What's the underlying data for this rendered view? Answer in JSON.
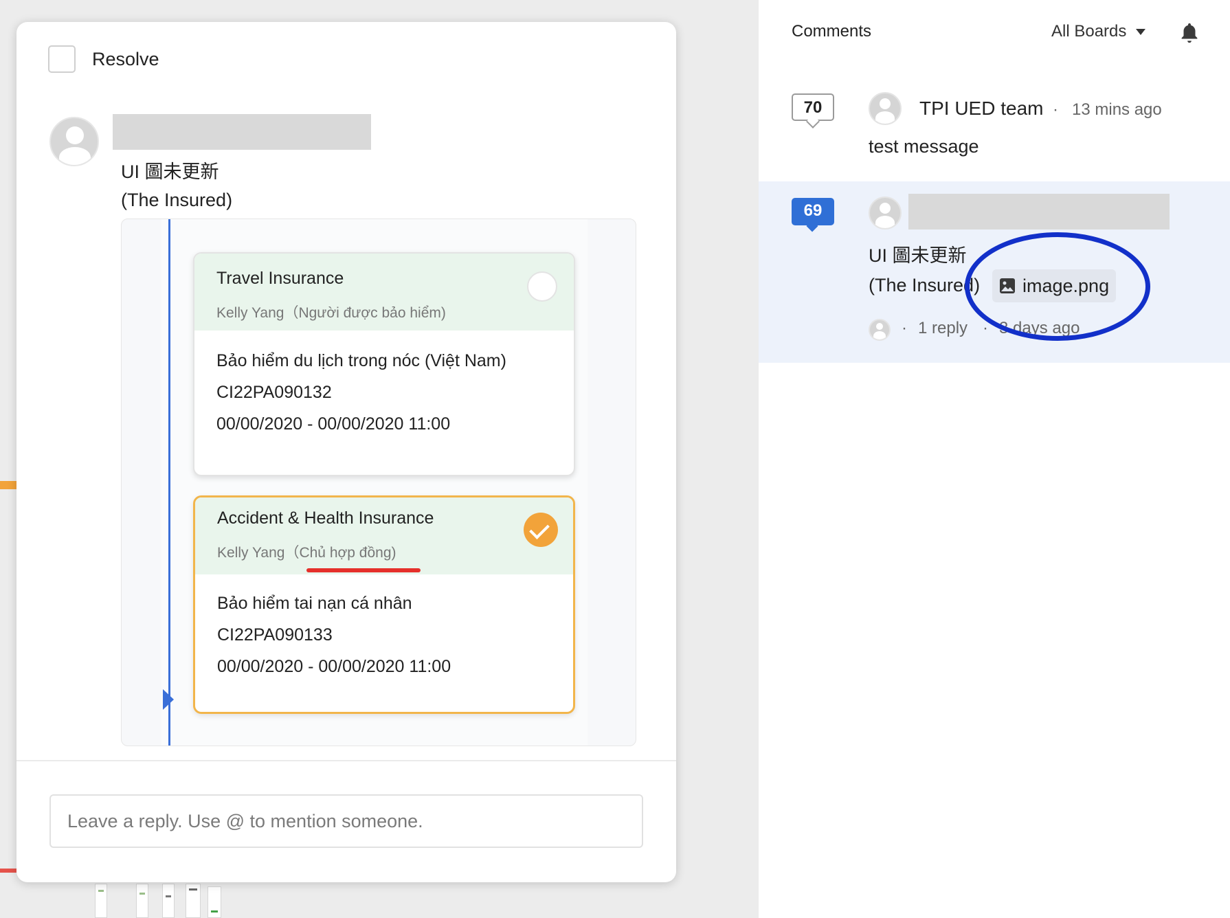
{
  "thread": {
    "resolve_label": "Resolve",
    "message_line1": "UI 圖未更新",
    "message_line2": "(The Insured)",
    "attachment": {
      "cards": [
        {
          "title": "Travel Insurance",
          "holder": "Kelly Yang（Người được bảo hiểm)",
          "product": "Bảo hiểm du lịch  trong nóc (Việt Nam)",
          "policy_no": "CI22PA090132",
          "period": "00/00/2020 - 00/00/2020 11:00",
          "selected": false
        },
        {
          "title": "Accident & Health Insurance",
          "holder": "Kelly Yang（Chủ hợp đồng)",
          "product": "Bảo hiểm tai nạn cá nhân",
          "policy_no": "CI22PA090133",
          "period": "00/00/2020 - 00/00/2020 11:00",
          "selected": true
        }
      ]
    },
    "reply_placeholder": "Leave a reply. Use @ to mention someone."
  },
  "sidebar": {
    "title": "Comments",
    "filter_label": "All Boards",
    "comments": [
      {
        "number": "70",
        "author": "TPI UED team",
        "separator": "·",
        "time": "13 mins ago",
        "text": "test message"
      },
      {
        "number": "69",
        "text_line1": "UI 圖未更新",
        "text_line2": "(The Insured)",
        "attachment_name": "image.png",
        "separator": "·",
        "reply_count": "1 reply",
        "time": "3 days ago"
      }
    ]
  },
  "colors": {
    "accent_blue": "#2f6fd6",
    "highlight_circle": "#1230c9",
    "selected_orange": "#f2a33a",
    "selected_row_bg": "#edf2fb"
  }
}
